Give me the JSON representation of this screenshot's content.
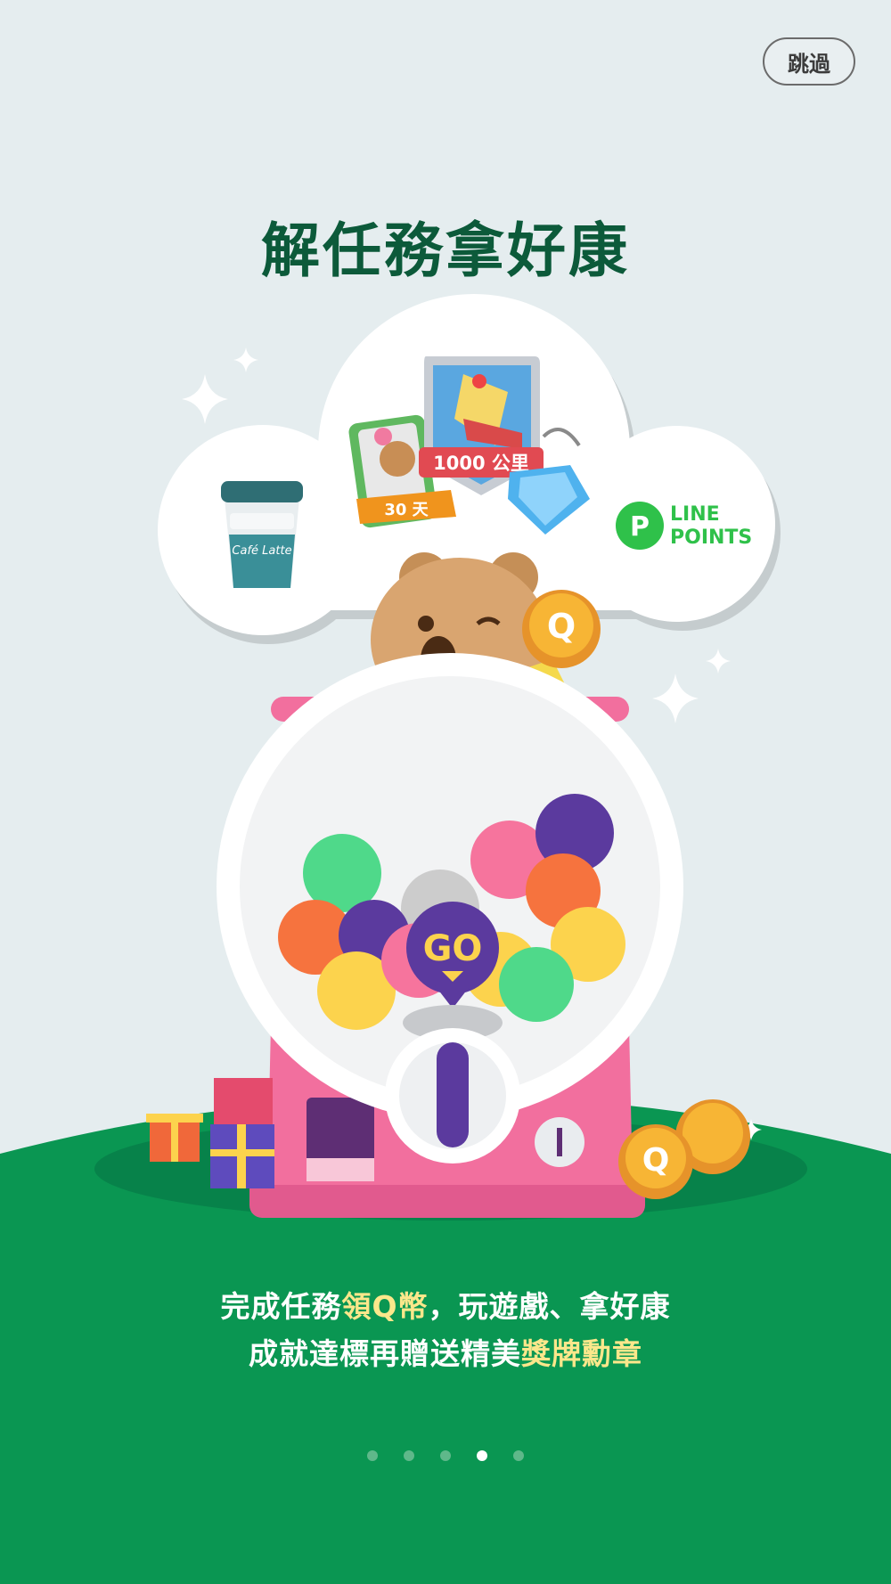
{
  "header": {
    "skip_label": "跳過"
  },
  "page_title": "解任務拿好康",
  "illustration": {
    "badge_distance": "1000 公里",
    "badge_days": "30 天",
    "line_points_line1": "LINE",
    "line_points_line2": "POINTS",
    "line_points_logo_letter": "P",
    "coin_letter": "Q",
    "go_label": "GO",
    "coffee_script": "Café Latte"
  },
  "caption": {
    "line1_a": "完成任務",
    "line1_b": "領Q幣",
    "line1_c": "，玩遊戲、拿好康",
    "line2_a": "成就達標再贈送精美",
    "line2_b": "獎牌勳章"
  },
  "pagination": {
    "total": 5,
    "active_index": 3
  },
  "colors": {
    "background": "#e5edef",
    "title": "#0c5a3a",
    "ground": "#0a9652",
    "caption_text": "#ffffff",
    "caption_highlight": "#fbe78b",
    "machine_pink": "#ee6b99",
    "go_purple": "#5b3a9e"
  },
  "icons": [
    "sparkle-icon",
    "coin-icon",
    "gift-icon",
    "diamond-icon",
    "line-points-icon"
  ]
}
